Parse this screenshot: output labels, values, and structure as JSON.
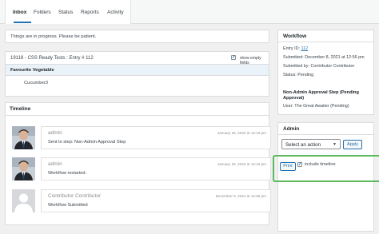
{
  "tabs": [
    "Inbox",
    "Folders",
    "Status",
    "Reports",
    "Activity"
  ],
  "notice": "Things are in progress. Please be patient.",
  "entry": {
    "title": "19118 - CSS Ready Tests : Entry # 112",
    "show_empty_label": "show empty fields",
    "field_label": "Favourite Vegetable",
    "field_value": "Cucumber3"
  },
  "timeline": {
    "title": "Timeline",
    "notes": [
      {
        "name": "admin",
        "date": "January 26, 2022 at 12:16 pm",
        "text": "Sent to step: Non-Admin Approval Step"
      },
      {
        "name": "admin",
        "date": "January 26, 2022 at 12:16 pm",
        "text": "Workflow restarted."
      },
      {
        "name": "Contributor Contributor",
        "date": "December 8, 2021 at 12:56 pm",
        "text": "Workflow Submitted"
      }
    ]
  },
  "workflow": {
    "title": "Workflow",
    "entry_id_label": "Entry ID:",
    "entry_id": "112",
    "submitted": "Submitted: December 8, 2021 at 12:56 pm",
    "submitted_by": "Submitted by: Contributor Contributor",
    "status": "Status: Pending",
    "step_line1": "Non-Admin Approval Step (Pending",
    "step_line2": "Approval)",
    "user": "User: The Great Awaiter (Pending)"
  },
  "admin": {
    "title": "Admin",
    "select_value": "Select an action",
    "apply_label": "Apply",
    "print_label": "Print",
    "include_timeline_label": "include timeline",
    "include_timeline_checked": true
  },
  "colors": {
    "accent": "#2271b1",
    "highlight_border": "#5cb85c"
  }
}
